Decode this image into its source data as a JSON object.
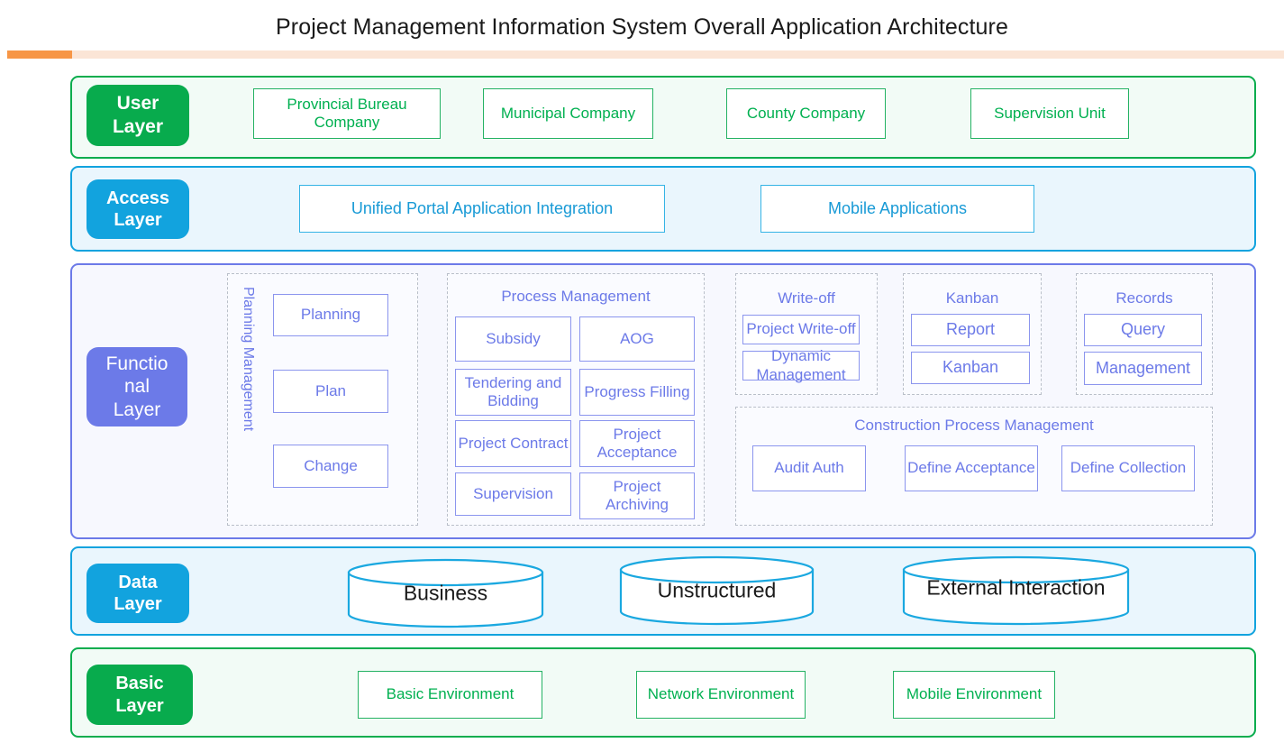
{
  "title": "Project Management Information System Overall Application Architecture",
  "accent": {
    "orange": "#f79646",
    "peach": "#fbe5d6"
  },
  "colors": {
    "green": "#00b050",
    "blue": "#12a3de",
    "purple": "#6c7ae8",
    "cylinder_stroke": "#1aa8e0",
    "title_text": "#1a1a1a"
  },
  "layers": {
    "user": {
      "badge": "User\nLayer",
      "badge_line1": "User",
      "badge_line2": "Layer",
      "items": [
        {
          "label": "Provincial Bureau Company"
        },
        {
          "label": "Municipal Company"
        },
        {
          "label": "County Company"
        },
        {
          "label": "Supervision Unit"
        }
      ]
    },
    "access": {
      "badge_line1": "Access",
      "badge_line2": "Layer",
      "items": [
        {
          "label": "Unified Portal Application Integration"
        },
        {
          "label": "Mobile Applications"
        }
      ]
    },
    "functional": {
      "badge_line1": "Functio",
      "badge_line2": "nal",
      "badge_line3": "Layer",
      "planning": {
        "vertical_label": "Planning Management",
        "items": [
          {
            "label": "Planning"
          },
          {
            "label": "Plan"
          },
          {
            "label": "Change"
          }
        ]
      },
      "process": {
        "title": "Process Management",
        "items": [
          {
            "label": "Subsidy"
          },
          {
            "label": "AOG"
          },
          {
            "label": "Tendering and Bidding"
          },
          {
            "label": "Progress Filling"
          },
          {
            "label": "Project Contract"
          },
          {
            "label": "Project Acceptance"
          },
          {
            "label": "Supervision"
          },
          {
            "label": "Project Archiving"
          }
        ]
      },
      "writeoff": {
        "title": "Write-off",
        "items": [
          {
            "label": "Project Write-off"
          },
          {
            "label": "Dynamic Management"
          }
        ]
      },
      "kanban": {
        "title": "Kanban",
        "items": [
          {
            "label": "Report"
          },
          {
            "label": "Kanban"
          }
        ]
      },
      "records": {
        "title": "Records",
        "items": [
          {
            "label": "Query"
          },
          {
            "label": "Management"
          }
        ]
      },
      "construction": {
        "title": "Construction Process Management",
        "items": [
          {
            "label": "Audit Auth"
          },
          {
            "label": "Define Acceptance"
          },
          {
            "label": "Define Collection"
          }
        ]
      }
    },
    "data": {
      "badge_line1": "Data",
      "badge_line2": "Layer",
      "items": [
        {
          "label": "Business"
        },
        {
          "label": "Unstructured"
        },
        {
          "label": "External Interaction"
        }
      ]
    },
    "basic": {
      "badge_line1": "Basic",
      "badge_line2": "Layer",
      "items": [
        {
          "label": "Basic Environment"
        },
        {
          "label": "Network Environment"
        },
        {
          "label": "Mobile Environment"
        }
      ]
    }
  }
}
